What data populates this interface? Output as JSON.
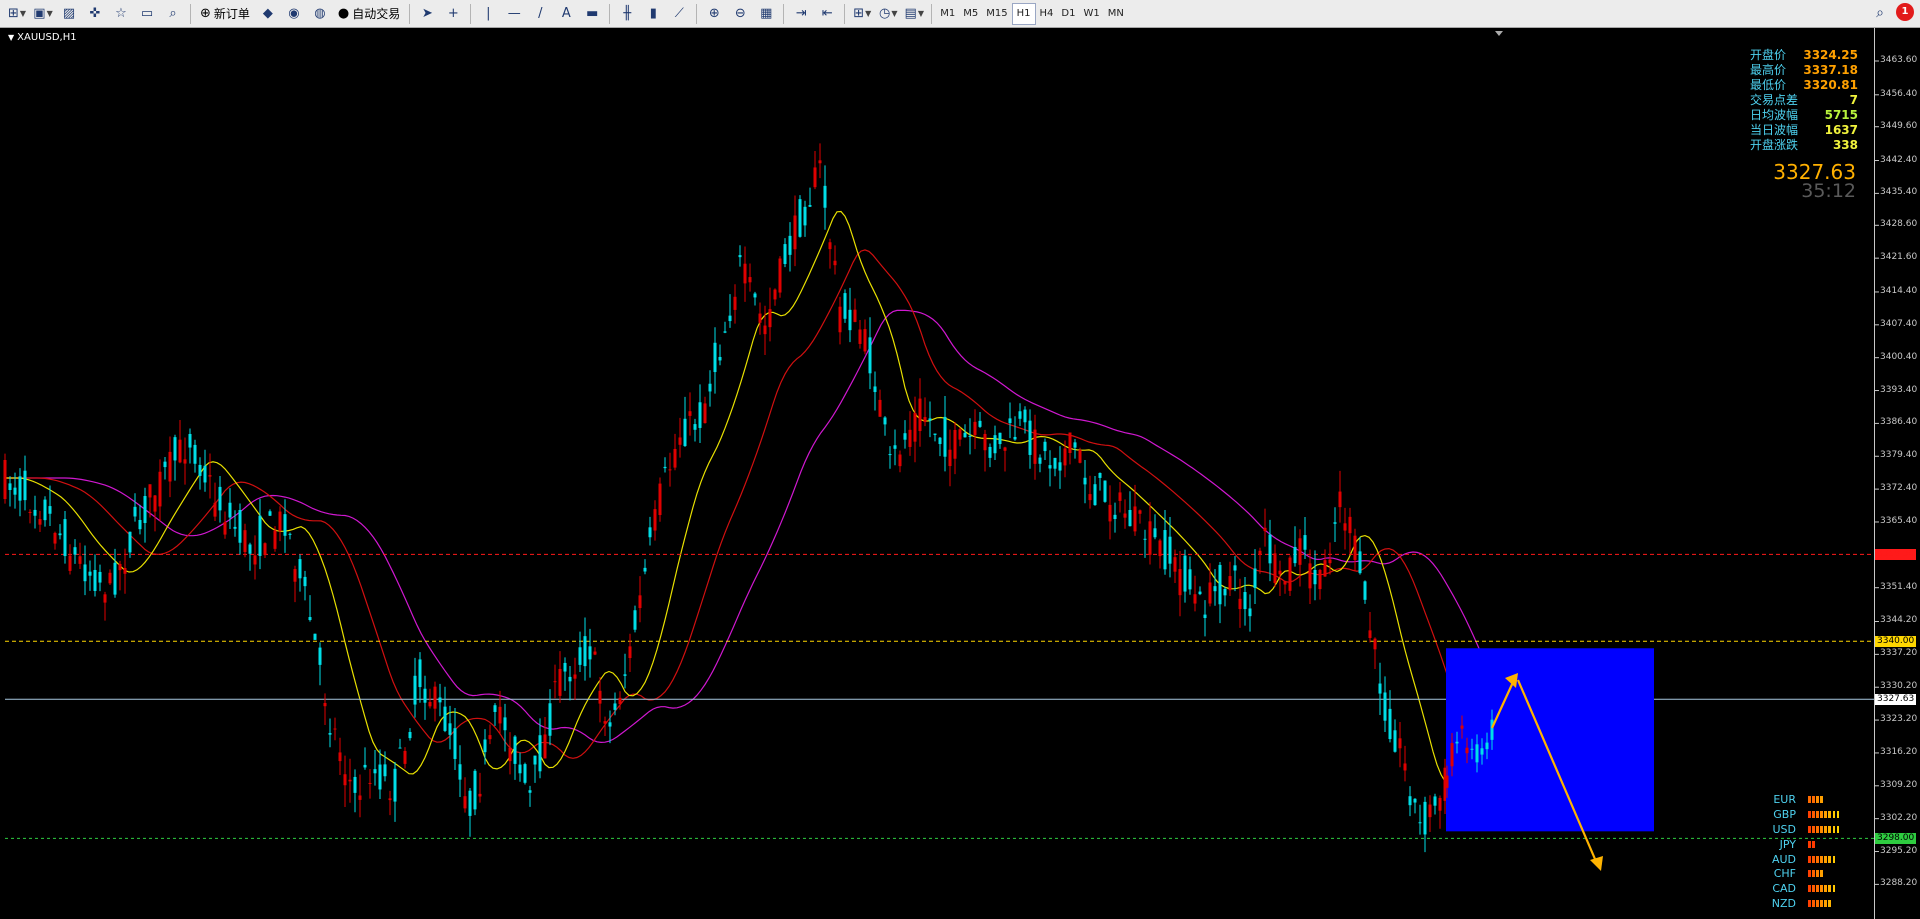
{
  "toolbar": {
    "buttons": [
      {
        "name": "new-chart-button",
        "icon": "new-chart-icon",
        "glyph": "⊞",
        "dropdown": true
      },
      {
        "name": "profiles-button",
        "icon": "profiles-icon",
        "glyph": "▣",
        "dropdown": true
      },
      {
        "name": "market-watch-button",
        "icon": "market-watch-icon",
        "glyph": "▨"
      },
      {
        "name": "data-window-button",
        "icon": "crosshair-icon",
        "glyph": "✜"
      },
      {
        "name": "navigator-button",
        "icon": "navigator-icon",
        "glyph": "☆"
      },
      {
        "name": "terminal-button",
        "icon": "terminal-icon",
        "glyph": "▭"
      },
      {
        "name": "tester-button",
        "icon": "tester-icon",
        "glyph": "⌕"
      },
      {
        "sep": true
      },
      {
        "name": "new-order-button",
        "icon": "new-order-icon",
        "glyph": "⊕",
        "label": "新订单"
      },
      {
        "name": "metaeditor-button",
        "icon": "metaeditor-icon",
        "glyph": "◆"
      },
      {
        "name": "signals-button",
        "icon": "signals-icon",
        "glyph": "◉"
      },
      {
        "name": "radio-button",
        "icon": "radio-icon",
        "glyph": "◍"
      },
      {
        "name": "autotrading-button",
        "icon": "autotrading-icon",
        "glyph": "●",
        "label": "自动交易"
      },
      {
        "sep": true
      },
      {
        "name": "cursor-button",
        "icon": "cursor-icon",
        "glyph": "➤"
      },
      {
        "name": "crosshair-button",
        "icon": "crosshair-tool-icon",
        "glyph": "+"
      },
      {
        "sep": true
      },
      {
        "name": "vertical-line-button",
        "icon": "vertical-line-icon",
        "glyph": "|"
      },
      {
        "name": "horizontal-line-button",
        "icon": "horizontal-line-icon",
        "glyph": "—"
      },
      {
        "name": "trendline-button",
        "icon": "trendline-icon",
        "glyph": "/"
      },
      {
        "name": "text-button",
        "icon": "text-icon",
        "glyph": "A"
      },
      {
        "name": "label-button",
        "icon": "label-icon",
        "glyph": "▬"
      },
      {
        "sep": true
      },
      {
        "name": "bar-chart-button",
        "icon": "bar-chart-icon",
        "glyph": "╫"
      },
      {
        "name": "candlestick-button",
        "icon": "candlestick-icon",
        "glyph": "▮"
      },
      {
        "name": "line-chart-button",
        "icon": "line-chart-icon",
        "glyph": "⟋"
      },
      {
        "sep": true
      },
      {
        "name": "zoom-in-button",
        "icon": "zoom-in-icon",
        "glyph": "⊕"
      },
      {
        "name": "zoom-out-button",
        "icon": "zoom-out-icon",
        "glyph": "⊖"
      },
      {
        "name": "tile-windows-button",
        "icon": "tile-windows-icon",
        "glyph": "▦"
      },
      {
        "sep": true
      },
      {
        "name": "autoscroll-button",
        "icon": "autoscroll-icon",
        "glyph": "⇥"
      },
      {
        "name": "chart-shift-button",
        "icon": "chart-shift-icon",
        "glyph": "⇤"
      },
      {
        "sep": true
      },
      {
        "name": "indicators-button",
        "icon": "indicators-icon",
        "glyph": "⊞",
        "dropdown": true
      },
      {
        "name": "periods-button",
        "icon": "clock-icon",
        "glyph": "◷",
        "dropdown": true
      },
      {
        "name": "templates-button",
        "icon": "templates-icon",
        "glyph": "▤",
        "dropdown": true
      },
      {
        "sep": true
      }
    ],
    "timeframes": [
      "M1",
      "M5",
      "M15",
      "H1",
      "H4",
      "D1",
      "W1",
      "MN"
    ],
    "active_timeframe": "H1",
    "alerts_count": "1"
  },
  "chart": {
    "title": "XAUUSD,H1",
    "info": [
      {
        "label": "开盘价",
        "value": "3324.25",
        "color": "#ffa000"
      },
      {
        "label": "最高价",
        "value": "3337.18",
        "color": "#ffa000"
      },
      {
        "label": "最低价",
        "value": "3320.81",
        "color": "#ffa000"
      },
      {
        "label": "交易点差",
        "value": "7",
        "color": "#f0f23c"
      },
      {
        "label": "日均波幅",
        "value": "5715",
        "color": "#b8f23c"
      },
      {
        "label": "当日波幅",
        "value": "1637",
        "color": "#f0f23c"
      },
      {
        "label": "开盘涨跌",
        "value": "338",
        "color": "#f0f23c"
      }
    ],
    "current_price": "3327.63",
    "countdown": "35:12",
    "price_levels": {
      "resistance": {
        "value": 3358.5,
        "label": "3358.50",
        "color": "#ff1a1a"
      },
      "pivot": {
        "value": 3340.0,
        "label": "3340.00",
        "color": "#ffd700"
      },
      "bid": {
        "value": 3327.63,
        "label": "3327.63",
        "color": "#a8c8e0"
      },
      "support": {
        "value": 3298.0,
        "label": "3298.00",
        "color": "#2ecc40"
      }
    },
    "price_ticks": [
      "3463.60",
      "3456.40",
      "3449.60",
      "3442.40",
      "3435.40",
      "3428.60",
      "3421.60",
      "3414.40",
      "3407.40",
      "3400.40",
      "3393.40",
      "3386.40",
      "3379.40",
      "3372.40",
      "3365.40",
      "3351.40",
      "3344.20",
      "3337.20",
      "3330.20",
      "3323.20",
      "3316.20",
      "3309.20",
      "3302.20",
      "3295.20",
      "3288.20"
    ],
    "currencies": [
      {
        "name": "EUR",
        "strength": 4,
        "colors": [
          "#ff6a00",
          "#ff6a00",
          "#ff8c00",
          "#ffa000"
        ]
      },
      {
        "name": "GBP",
        "strength": 8,
        "colors": [
          "#ff4000",
          "#ff5a00",
          "#ff7000",
          "#ff8c00",
          "#ffa000",
          "#ffb400",
          "#ffc800",
          "#ffd400"
        ]
      },
      {
        "name": "USD",
        "strength": 8,
        "colors": [
          "#ff4000",
          "#ff5a00",
          "#ff7000",
          "#ff8c00",
          "#ffa000",
          "#ffb400",
          "#ffc800",
          "#ffd400"
        ]
      },
      {
        "name": "JPY",
        "strength": 2,
        "colors": [
          "#ff3a00",
          "#ff3a00"
        ]
      },
      {
        "name": "AUD",
        "strength": 7,
        "colors": [
          "#ff4000",
          "#ff5a00",
          "#ff7000",
          "#ff8c00",
          "#ffa000",
          "#ffb400",
          "#ffc800"
        ]
      },
      {
        "name": "CHF",
        "strength": 4,
        "colors": [
          "#ff4000",
          "#ff6000",
          "#ff8000",
          "#ffa000"
        ]
      },
      {
        "name": "CAD",
        "strength": 7,
        "colors": [
          "#ff4000",
          "#ff5a00",
          "#ff7000",
          "#ff8c00",
          "#ffa000",
          "#ffb400",
          "#ffc800"
        ]
      },
      {
        "name": "NZD",
        "strength": 6,
        "colors": [
          "#ff4000",
          "#ff5a00",
          "#ff7000",
          "#ff8c00",
          "#ffa000",
          "#ffb400"
        ]
      }
    ]
  },
  "colors": {
    "bull_candle": "#00dfe8",
    "bear_candle": "#e00000",
    "ma_fast": "#e8e000",
    "ma_mid": "#d01010",
    "ma_slow": "#d018d0",
    "zone": "#0000ff",
    "arrow": "#ffb300"
  }
}
